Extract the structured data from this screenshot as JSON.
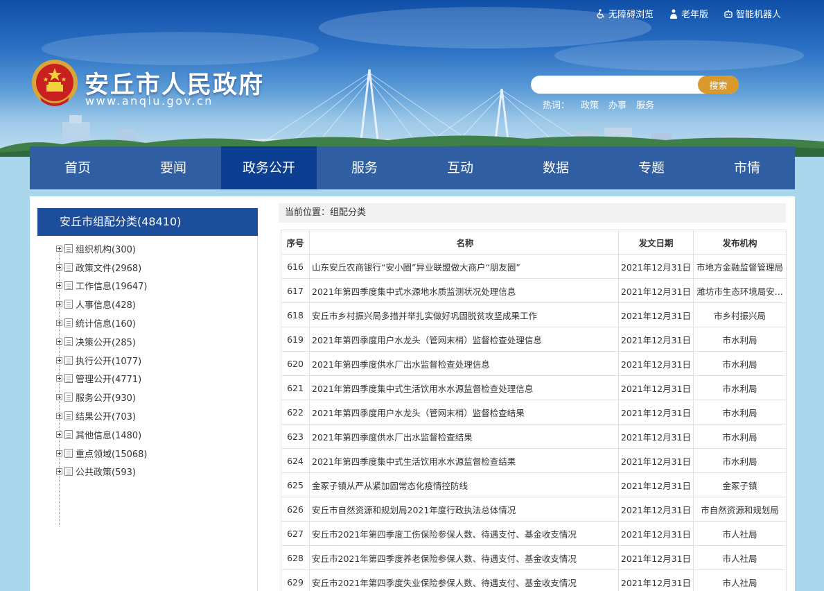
{
  "top_links": [
    {
      "label": "无障碍浏览",
      "icon": "wheelchair-icon"
    },
    {
      "label": "老年版",
      "icon": "elderly-icon"
    },
    {
      "label": "智能机器人",
      "icon": "robot-icon"
    }
  ],
  "header": {
    "title": "安丘市人民政府",
    "url": "www.anqiu.gov.cn",
    "emblem_icon": "national-emblem-icon"
  },
  "search": {
    "placeholder": "",
    "button_label": "搜索",
    "hot_label": "热词：",
    "hot_words": [
      "政策",
      "办事",
      "服务"
    ]
  },
  "nav": {
    "active_index": 2,
    "items": [
      "首页",
      "要闻",
      "政务公开",
      "服务",
      "互动",
      "数据",
      "专题",
      "市情"
    ]
  },
  "sidebar": {
    "title": "安丘市组配分类(48410)",
    "items": [
      "组织机构(300)",
      "政策文件(2968)",
      "工作信息(19647)",
      "人事信息(428)",
      "统计信息(160)",
      "决策公开(285)",
      "执行公开(1077)",
      "管理公开(4771)",
      "服务公开(930)",
      "结果公开(703)",
      "其他信息(1480)",
      "重点领域(15068)",
      "公共政策(593)"
    ]
  },
  "breadcrumb": "当前位置：组配分类",
  "table": {
    "headers": {
      "no": "序号",
      "name": "名称",
      "date": "发文日期",
      "org": "发布机构"
    },
    "rows": [
      {
        "no": "616",
        "name": "山东安丘农商银行“安小圈”异业联盟做大商户“朋友圈”",
        "date": "2021年12月31日",
        "org": "市地方金融监督管理局"
      },
      {
        "no": "617",
        "name": "2021年第四季度集中式水源地水质监测状况处理信息",
        "date": "2021年12月31日",
        "org": "潍坊市生态环境局安..."
      },
      {
        "no": "618",
        "name": "安丘市乡村振兴局多措并举扎实做好巩固脱贫攻坚成果工作",
        "date": "2021年12月31日",
        "org": "市乡村振兴局"
      },
      {
        "no": "619",
        "name": "2021年第四季度用户水龙头（管网末梢）监督检查处理信息",
        "date": "2021年12月31日",
        "org": "市水利局"
      },
      {
        "no": "620",
        "name": "2021年第四季度供水厂出水监督检查处理信息",
        "date": "2021年12月31日",
        "org": "市水利局"
      },
      {
        "no": "621",
        "name": "2021年第四季度集中式生活饮用水水源监督检查处理信息",
        "date": "2021年12月31日",
        "org": "市水利局"
      },
      {
        "no": "622",
        "name": "2021年第四季度用户水龙头（管网末梢）监督检查结果",
        "date": "2021年12月31日",
        "org": "市水利局"
      },
      {
        "no": "623",
        "name": "2021年第四季度供水厂出水监督检查结果",
        "date": "2021年12月31日",
        "org": "市水利局"
      },
      {
        "no": "624",
        "name": "2021年第四季度集中式生活饮用水水源监督检查结果",
        "date": "2021年12月31日",
        "org": "市水利局"
      },
      {
        "no": "625",
        "name": "金冢子镇从严从紧加固常态化疫情控防线",
        "date": "2021年12月31日",
        "org": "金冢子镇"
      },
      {
        "no": "626",
        "name": "安丘市自然资源和规划局2021年度行政执法总体情况",
        "date": "2021年12月31日",
        "org": "市自然资源和规划局"
      },
      {
        "no": "627",
        "name": "安丘市2021年第四季度工伤保险参保人数、待遇支付、基金收支情况",
        "date": "2021年12月31日",
        "org": "市人社局"
      },
      {
        "no": "628",
        "name": "安丘市2021年第四季度养老保险参保人数、待遇支付、基金收支情况",
        "date": "2021年12月31日",
        "org": "市人社局"
      },
      {
        "no": "629",
        "name": "安丘市2021年第四季度失业保险参保人数、待遇支付、基金收支情况",
        "date": "2021年12月31日",
        "org": "市人社局"
      }
    ]
  },
  "colors": {
    "nav_bg": "#2f5fa2",
    "nav_active": "#0c3f92",
    "sidebar_title_bg": "#1d4e9b",
    "search_button": "#d99a2b",
    "page_bg": "#a9d6ea"
  }
}
